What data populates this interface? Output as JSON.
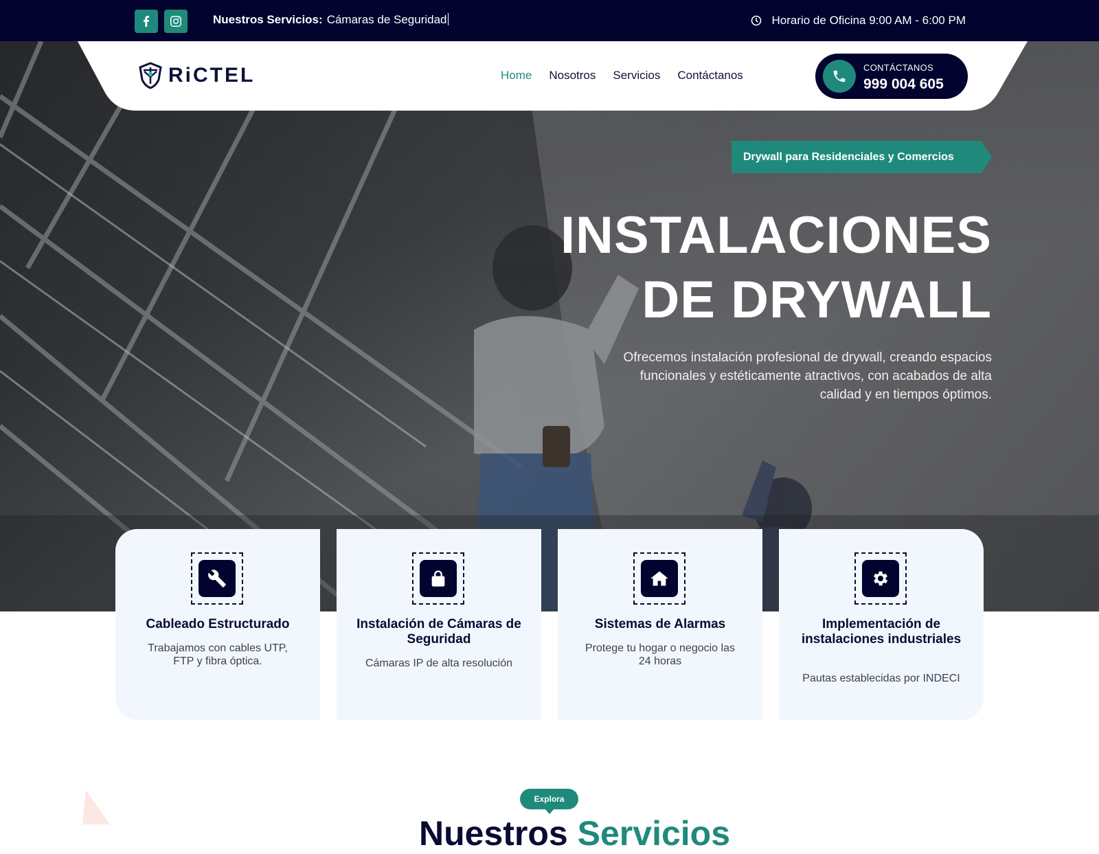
{
  "topbar": {
    "ticker_label": "Nuestros Servicios:",
    "ticker_value": "Cámaras de Seguridad",
    "hours": "Horario de Oficina 9:00 AM - 6:00 PM",
    "social": [
      "facebook-icon",
      "instagram-icon"
    ]
  },
  "header": {
    "logo_text": "RiCTEL",
    "nav": [
      {
        "label": "Home",
        "active": true
      },
      {
        "label": "Nosotros",
        "active": false
      },
      {
        "label": "Servicios",
        "active": false
      },
      {
        "label": "Contáctanos",
        "active": false
      }
    ],
    "contact_label": "CONTÁCTANOS",
    "contact_phone": "999 004 605"
  },
  "hero": {
    "tag": "Drywall para Residenciales y Comercios",
    "headline_line1": "INSTALACIONES",
    "headline_line2": "DE DRYWALL",
    "lead": "Ofrecemos instalación profesional de drywall, creando espacios funcionales y estéticamente atractivos, con acabados de alta calidad y en tiempos óptimos."
  },
  "services": [
    {
      "title": "Cableado Estructurado",
      "desc": "Trabajamos con cables UTP, FTP y fibra óptica.",
      "icon": "wrench-icon"
    },
    {
      "title": "Instalación de Cámaras de Seguridad",
      "desc": "Cámaras IP de alta resolución",
      "icon": "lock-icon"
    },
    {
      "title": "Sistemas de Alarmas",
      "desc": "Protege tu hogar o negocio las 24 horas",
      "icon": "home-icon"
    },
    {
      "title": "Implementación de instalaciones industriales",
      "desc": "Pautas establecidas por INDECI",
      "icon": "gear-icon"
    }
  ],
  "section": {
    "badge": "Explora",
    "title_part1": "Nuestros",
    "title_part2": "Servicios"
  },
  "colors": {
    "navy": "#02032e",
    "teal": "#1f8a7c",
    "card_bg": "#f2f7fd"
  }
}
